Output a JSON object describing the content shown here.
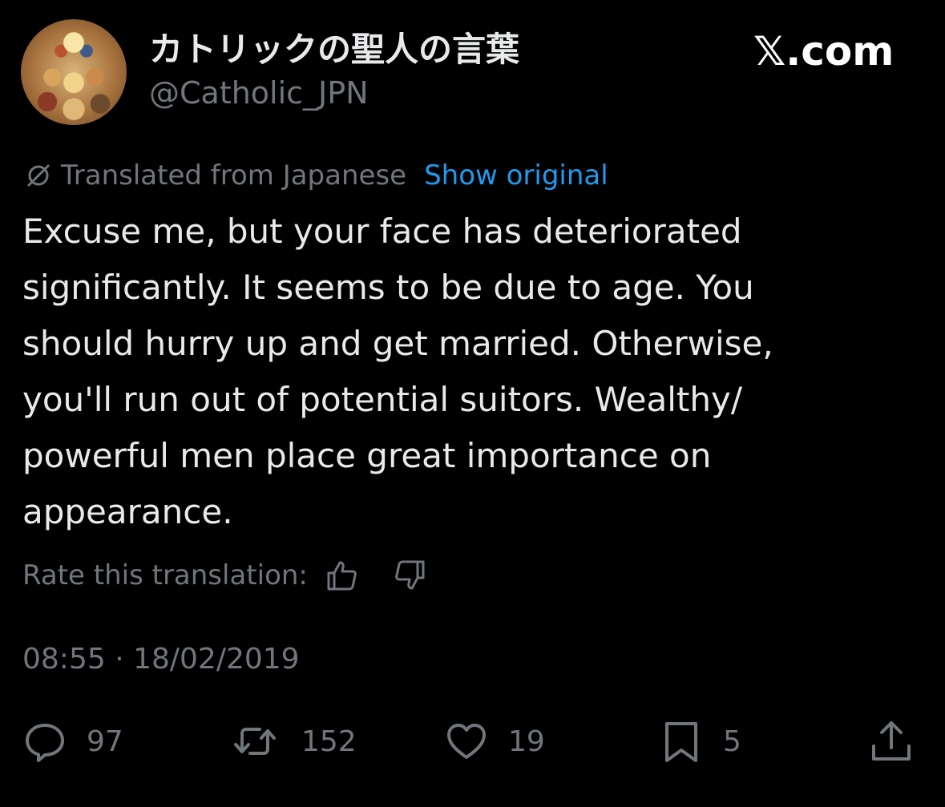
{
  "author": {
    "display_name": "カトリックの聖人の言葉",
    "handle": "@Catholic_JPN"
  },
  "brand": {
    "label": "𝕏.com"
  },
  "translation": {
    "icon": "translate-icon",
    "label": "Translated from Japanese",
    "show_original": "Show original",
    "rate_label": "Rate this translation:"
  },
  "tweet": {
    "lines": [
      "Excuse me, but your face has deteriorated",
      "significantly. It seems to be due to age. You",
      "should hurry up and get married. Otherwise,",
      "you'll run out of potential suitors. Wealthy/",
      "powerful men place great importance on",
      "appearance."
    ],
    "timestamp": "08:55 · 18/02/2019"
  },
  "actions": {
    "reply": {
      "icon": "reply-icon",
      "count": "97"
    },
    "retweet": {
      "icon": "retweet-icon",
      "count": "152"
    },
    "like": {
      "icon": "heart-icon",
      "count": "19"
    },
    "bookmark": {
      "icon": "bookmark-icon",
      "count": "5"
    },
    "share": {
      "icon": "share-icon"
    }
  },
  "colors": {
    "background": "#000000",
    "text": "#e7e9ea",
    "secondary": "#71767b",
    "accent": "#1d9bf0"
  }
}
